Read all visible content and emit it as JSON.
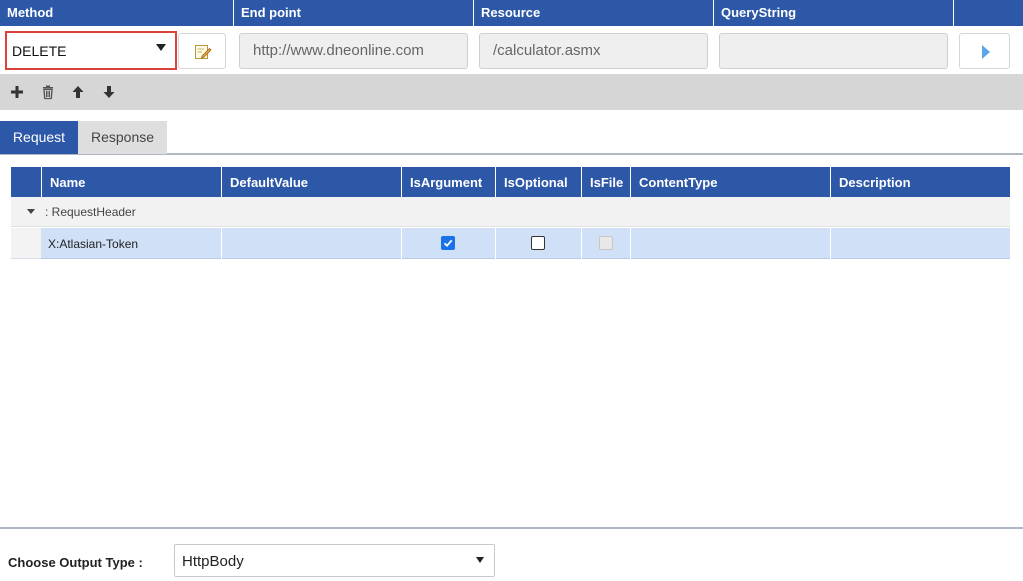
{
  "header": {
    "columns": [
      "Method",
      "End point",
      "Resource",
      "QueryString"
    ]
  },
  "request": {
    "method": "DELETE",
    "endpoint": "http://www.dneonline.com",
    "resource": "/calculator.asmx",
    "querystring": ""
  },
  "icons": {
    "edit": "pencil-note-icon",
    "run": "play-icon",
    "add": "plus-icon",
    "delete": "trash-icon",
    "up": "arrow-up-icon",
    "down": "arrow-down-icon"
  },
  "tabs": [
    {
      "label": "Request",
      "active": true
    },
    {
      "label": "Response",
      "active": false
    }
  ],
  "grid": {
    "columns": [
      "Name",
      "DefaultValue",
      "IsArgument",
      "IsOptional",
      "IsFile",
      "ContentType",
      "Description"
    ],
    "group_label": ": RequestHeader",
    "rows": [
      {
        "name": "X:Atlasian-Token",
        "default_value": "",
        "is_argument": true,
        "is_optional": false,
        "is_file": false,
        "content_type": "",
        "description": ""
      }
    ]
  },
  "output": {
    "label": "Choose Output Type :",
    "value": "HttpBody"
  },
  "colors": {
    "header_blue": "#2d58a8",
    "selected_row": "#cfe0f7",
    "highlight_border": "#d9433a",
    "run_icon": "#5aa7e8"
  }
}
